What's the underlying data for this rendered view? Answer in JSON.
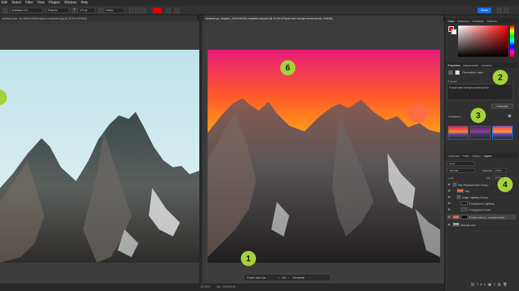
{
  "menu": [
    "Edit",
    "Select",
    "Filter",
    "View",
    "Plugins",
    "Window",
    "Help"
  ],
  "options_bar": {
    "font_family": "Kobeljum Oc...",
    "font_style": "Regular",
    "font_size": "170 pt",
    "aa_mode": "Sharp",
    "share_label": "Share"
  },
  "tabs": {
    "left": "abstract-gra...tp-uf3KAOWjRzHyjou4-unsplash.jpg @ 33.3% (RGB/8)",
    "right": "abstract-gr...aelpper_TjUKHKX3k-unsplash-sky.psd @ 33.3% (Purple and orange sunset photo, RGB/8)"
  },
  "panels": {
    "color_tabs": [
      "Color",
      "Swatches",
      "Gradients",
      "Patterns"
    ],
    "properties_tabs": [
      "Properties",
      "Adjustments",
      "Libraries"
    ],
    "generative_layer": "Generative Layer",
    "prompt_label": "Prompt",
    "prompt_value": "Purple and orange sunset photo",
    "generate_button": "Generate",
    "variations_label": "Variations",
    "layers_tabs": [
      "Channels",
      "Paths",
      "History",
      "Layers"
    ],
    "search_placeholder": "Kind",
    "blend_mode": "Normal",
    "opacity_label": "Opacity:",
    "opacity_value": "100%",
    "lock_label": "Lock:",
    "fill_label": "Fill:",
    "fill_value": "100%",
    "layers": [
      {
        "name": "Sky Replacement Group"
      },
      {
        "name": "Sky"
      },
      {
        "name": "Edge Lighting Group"
      },
      {
        "name": "Foreground Lighting"
      },
      {
        "name": "Foreground Color"
      },
      {
        "name": "Purple and or... sunset photo"
      },
      {
        "name": "Background"
      }
    ]
  },
  "context_bar": {
    "prompt": "Purple and ora...",
    "counter": "3/3",
    "generate": "Generate",
    "more": "···"
  },
  "status": {
    "zoom": "33.33%",
    "size": "3px: 3150/2100"
  },
  "callouts": [
    "1",
    "2",
    "3",
    "4",
    "6"
  ],
  "colors": {
    "accent": "#1473e6",
    "callout": "#a5d23a",
    "foreground_swatch": "#e00000"
  }
}
